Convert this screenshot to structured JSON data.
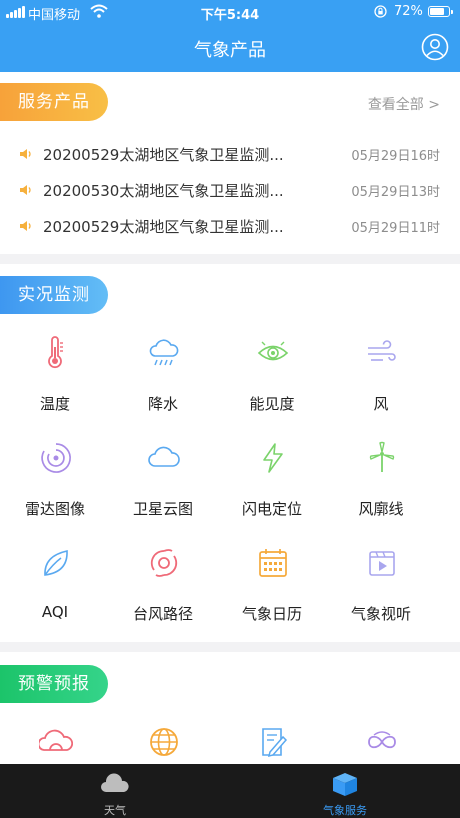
{
  "status_bar": {
    "carrier": "中国移动",
    "time": "下午5:44",
    "battery": "72%"
  },
  "header": {
    "title": "气象产品",
    "profile_icon": "user-circle-icon"
  },
  "service_products": {
    "label": "服务产品",
    "view_all": "查看全部 >",
    "items": [
      {
        "title": "20200529太湖地区气象卫星监测...",
        "date": "05月29日16时"
      },
      {
        "title": "20200530太湖地区气象卫星监测...",
        "date": "05月29日13时"
      },
      {
        "title": "20200529太湖地区气象卫星监测...",
        "date": "05月29日11时"
      }
    ]
  },
  "live_monitoring": {
    "label": "实况监测",
    "items": [
      {
        "label": "温度",
        "icon": "thermometer-icon"
      },
      {
        "label": "降水",
        "icon": "rain-cloud-icon"
      },
      {
        "label": "能见度",
        "icon": "eye-icon"
      },
      {
        "label": "风",
        "icon": "wind-icon"
      },
      {
        "label": "雷达图像",
        "icon": "radar-icon"
      },
      {
        "label": "卫星云图",
        "icon": "cloud-icon"
      },
      {
        "label": "闪电定位",
        "icon": "lightning-icon"
      },
      {
        "label": "风廓线",
        "icon": "wind-turbine-icon"
      },
      {
        "label": "AQI",
        "icon": "leaf-icon"
      },
      {
        "label": "台风路径",
        "icon": "typhoon-icon"
      },
      {
        "label": "气象日历",
        "icon": "calendar-icon"
      },
      {
        "label": "气象视听",
        "icon": "video-icon"
      }
    ]
  },
  "warning_forecast": {
    "label": "预警预报",
    "items": [
      {
        "icon": "cloud-warning-icon"
      },
      {
        "icon": "globe-icon"
      },
      {
        "icon": "document-pen-icon"
      },
      {
        "icon": "infinity-icon"
      }
    ]
  },
  "tab_bar": {
    "tabs": [
      {
        "label": "天气",
        "icon": "weather-cloud-icon",
        "active": false
      },
      {
        "label": "气象服务",
        "icon": "service-cube-icon",
        "active": true
      }
    ],
    "active_color": "#3a9bf4",
    "inactive_color": "#bdbdbd"
  },
  "colors": {
    "primary": "#39a0f3",
    "orange": "#f7a23a",
    "green": "#1cc46a"
  }
}
